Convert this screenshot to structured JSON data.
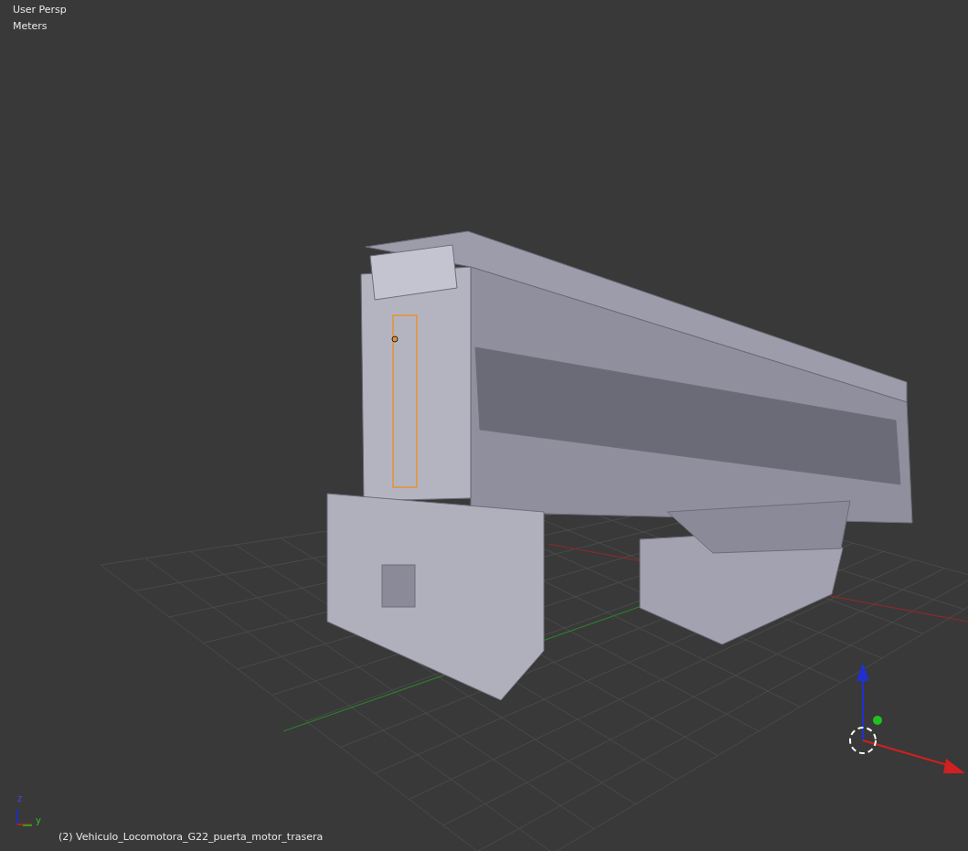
{
  "viewport": {
    "view_name": "User Persp",
    "units": "Meters",
    "object_label": "(2) Vehiculo_Locomotora_G22_puerta_motor_trasera",
    "axis_labels": [
      "z",
      "y"
    ]
  }
}
